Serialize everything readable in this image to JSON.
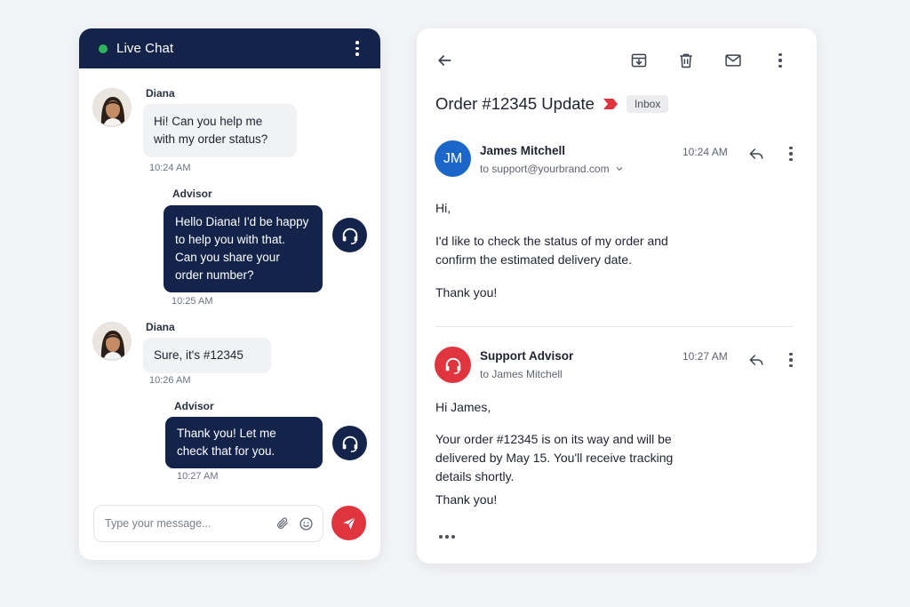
{
  "chat": {
    "title": "Live Chat",
    "status_color": "#2fb65c",
    "header_color": "#13234a",
    "messages": [
      {
        "from": "customer",
        "name": "Diana",
        "text_lines": [
          "Hi! Can you help me",
          "with my order status?"
        ],
        "time": "10:24 AM"
      },
      {
        "from": "advisor",
        "name": "Advisor",
        "text_lines": [
          "Hello Diana! I'd be happy",
          "to help you with that.",
          "Can you share your",
          "order number?"
        ],
        "time": "10:25 AM"
      },
      {
        "from": "customer",
        "name": "Diana",
        "text_lines": [
          "Sure, it's #12345"
        ],
        "time": "10:26 AM"
      },
      {
        "from": "advisor",
        "name": "Advisor",
        "text_lines": [
          "Thank you! Let me",
          "check that for you."
        ],
        "time": "10:27 AM"
      }
    ],
    "composer": {
      "placeholder": "Type your message...",
      "attach_icon": "paperclip-icon",
      "emoji_icon": "smiley-icon",
      "send_icon": "send-plane-icon",
      "send_color": "#e0353f"
    }
  },
  "mail": {
    "toolbar": [
      "back-arrow-icon",
      "archive-icon",
      "trash-icon",
      "mail-icon",
      "more-vertical-icon"
    ],
    "subject": "Order #12345 Update",
    "label": "Inbox",
    "important_color": "#e0353f",
    "messages": [
      {
        "avatar_initials": "JM",
        "avatar_color": "#1a66c9",
        "sender": "James Mitchell",
        "to": "to support@yourbrand.com",
        "time": "10:24 AM",
        "body": [
          "Hi,",
          "I'd like to check the status of my order and",
          "confirm the estimated delivery date.",
          "Thank you!"
        ]
      },
      {
        "avatar_icon": "headset-icon",
        "avatar_color": "#e0353f",
        "sender": "Support Advisor",
        "to": "to James Mitchell",
        "time": "10:27 AM",
        "body": [
          "Hi James,",
          "Your order #12345 is on its way and will be",
          "delivered by May 15. You'll receive tracking",
          "details shortly.",
          "Thank you!"
        ]
      }
    ]
  }
}
